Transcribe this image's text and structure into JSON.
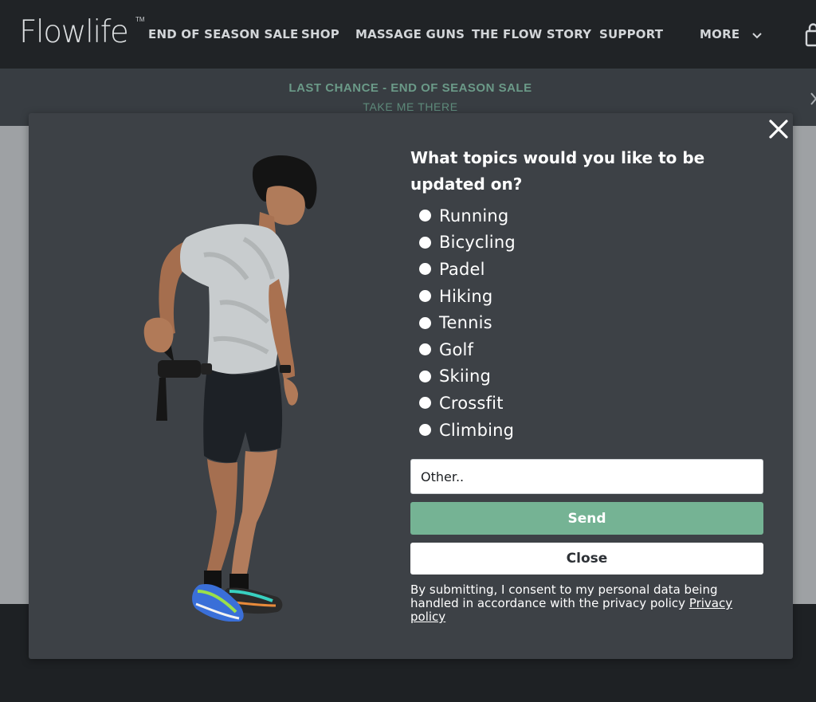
{
  "header": {
    "logo": "Flowlife",
    "trademark": "TM",
    "nav": {
      "sale": "END OF SEASON SALE",
      "shop": "SHOP",
      "guns": "MASSAGE GUNS",
      "story": "THE FLOW STORY",
      "support": "SUPPORT",
      "more": "MORE"
    }
  },
  "announcement": {
    "title": "LAST CHANCE - END OF SEASON SALE",
    "link": "TAKE ME THERE"
  },
  "modal": {
    "heading": "What topics would you like to be updated on?",
    "options": [
      "Running",
      "Bicycling",
      "Padel",
      "Hiking",
      "Tennis",
      "Golf",
      "Skiing",
      "Crossfit",
      "Climbing"
    ],
    "other_placeholder": "Other..",
    "send_label": "Send",
    "close_label": "Close",
    "consent_text": "By submitting, I consent to my personal data being handled in accordance with the privacy policy ",
    "privacy_link": "Privacy policy"
  },
  "colors": {
    "accent_green": "#75b394",
    "modal_bg": "#3d4146",
    "header_bg": "#202326"
  }
}
